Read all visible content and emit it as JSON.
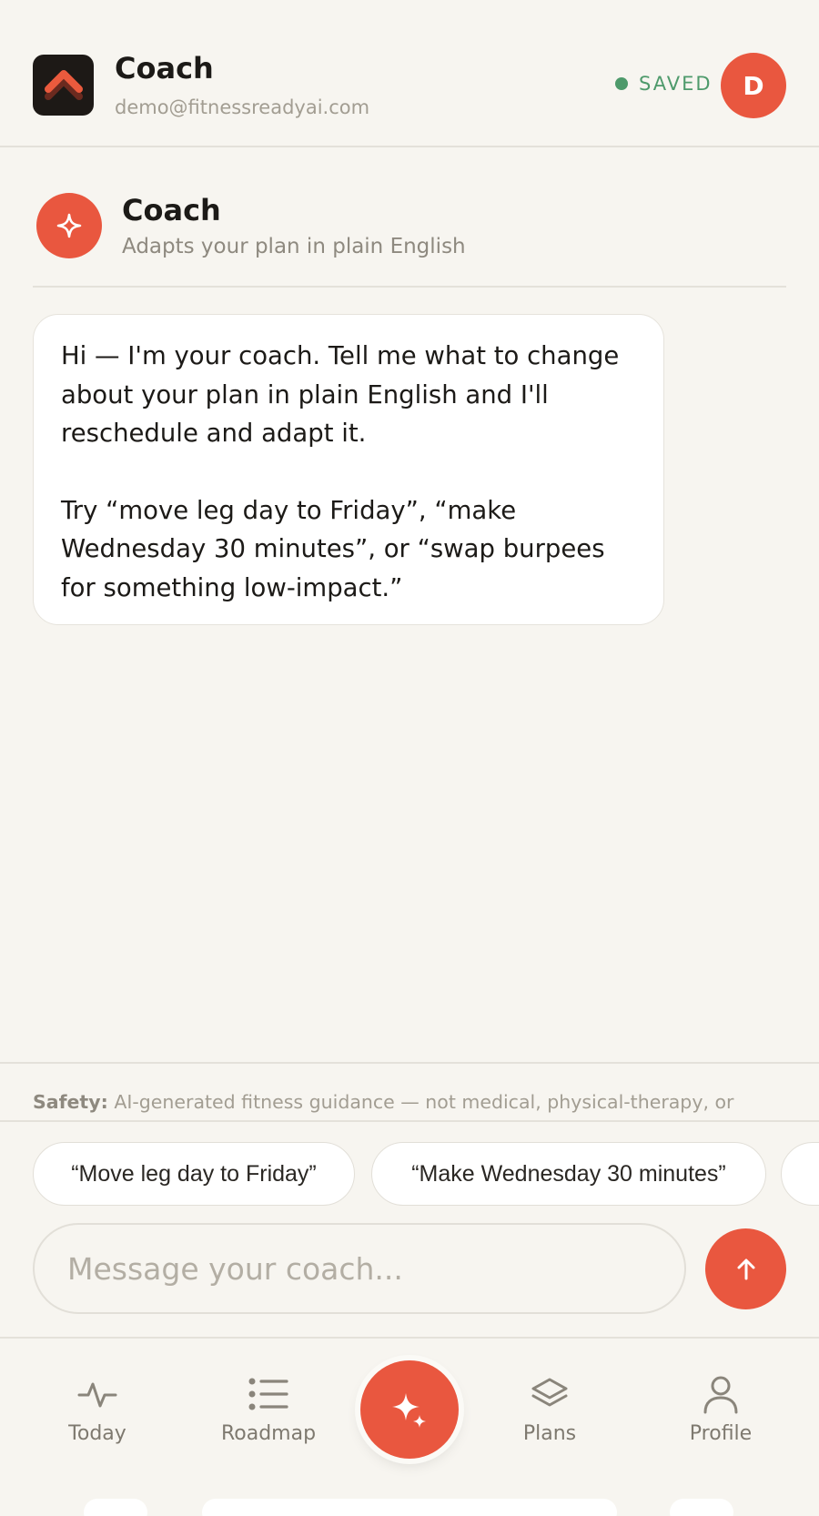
{
  "header": {
    "title": "Coach",
    "email": "demo@fitnessreadyai.com",
    "status": "SAVED",
    "avatar_initial": "D"
  },
  "coach": {
    "name": "Coach",
    "subtitle": "Adapts your plan in plain English"
  },
  "message": {
    "paragraph1": "Hi — I'm your coach. Tell me what to change about your plan in plain English and I'll reschedule and adapt it.",
    "paragraph2": "Try “move leg day to Friday”, “make Wednesday 30 minutes”, or “swap burpees for something low-impact.”"
  },
  "safety": {
    "label": "Safety:",
    "text": "AI-generated fitness guidance — not medical, physical-therapy, or"
  },
  "suggestions": [
    "“Move leg day to Friday”",
    "“Make Wednesday 30 minutes”",
    ""
  ],
  "composer": {
    "placeholder": "Message your coach..."
  },
  "nav": {
    "today": "Today",
    "roadmap": "Roadmap",
    "plans": "Plans",
    "profile": "Profile"
  },
  "colors": {
    "accent": "#e9573f",
    "saved": "#4e9a6b",
    "background": "#f7f5f0"
  }
}
